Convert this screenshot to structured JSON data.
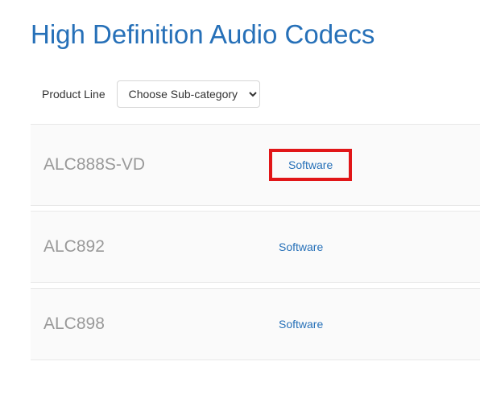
{
  "title": "High Definition Audio Codecs",
  "filter": {
    "label": "Product Line",
    "selected": "Choose Sub-category"
  },
  "products": [
    {
      "name": "ALC888S-VD",
      "link_label": "Software",
      "highlighted": true
    },
    {
      "name": "ALC892",
      "link_label": "Software",
      "highlighted": false
    },
    {
      "name": "ALC898",
      "link_label": "Software",
      "highlighted": false
    }
  ]
}
